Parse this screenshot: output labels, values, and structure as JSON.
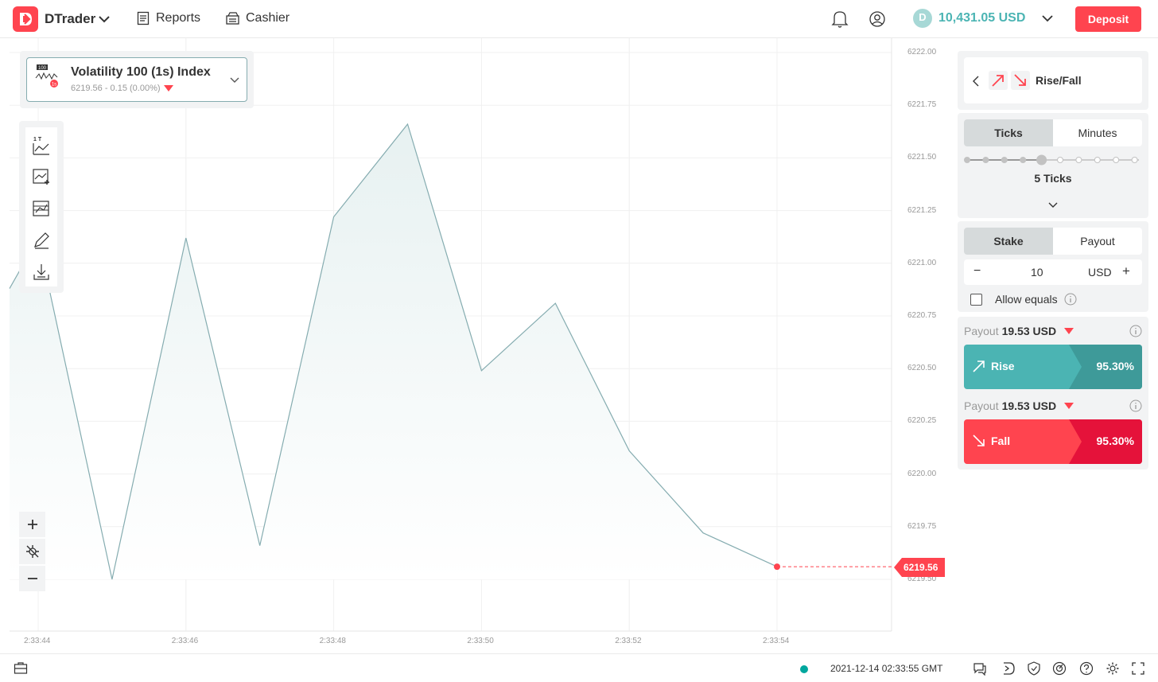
{
  "header": {
    "brand": "DTrader",
    "nav": [
      {
        "label": "Reports",
        "icon": "reports-icon"
      },
      {
        "label": "Cashier",
        "icon": "cashier-icon"
      }
    ],
    "balance": "10,431.05 USD",
    "currency_badge": "D",
    "deposit_label": "Deposit"
  },
  "market": {
    "title": "Volatility 100 (1s) Index",
    "icon_badge_top": "100",
    "icon_badge_bottom": "1s",
    "subtitle": "6219.56 - 0.15 (0.00%)"
  },
  "chart_toolbar": {
    "chart_type_label": "1 T"
  },
  "chart_data": {
    "type": "area",
    "x": [
      "2:33:43.6",
      "2:33:44",
      "2:33:45",
      "2:33:46",
      "2:33:47",
      "2:33:48",
      "2:33:49",
      "2:33:50",
      "2:33:51",
      "2:33:52",
      "2:33:53",
      "2:33:54"
    ],
    "values": [
      6220.88,
      6221.12,
      6219.5,
      6221.12,
      6219.66,
      6221.22,
      6221.66,
      6220.49,
      6220.81,
      6220.11,
      6219.72,
      6219.56
    ],
    "y_ticks": [
      "6222.00",
      "6221.75",
      "6221.50",
      "6221.25",
      "6221.00",
      "6220.75",
      "6220.50",
      "6220.25",
      "6220.00",
      "6219.75",
      "6219.50"
    ],
    "x_ticks": [
      "2:33:44",
      "2:33:46",
      "2:33:48",
      "2:33:50",
      "2:33:52",
      "2:33:54"
    ],
    "ylim": [
      6219.5,
      6222.0
    ],
    "current_price": "6219.56",
    "line_color": "#85acb0",
    "marker_color": "#ff444f"
  },
  "trade": {
    "contract_type": "Rise/Fall",
    "duration_tabs": [
      "Ticks",
      "Minutes"
    ],
    "duration_active": "Ticks",
    "ticks_value": "5 Ticks",
    "stake_tabs": [
      "Stake",
      "Payout"
    ],
    "stake_active": "Stake",
    "minus_label": "−",
    "plus_label": "+",
    "stake_value": "10",
    "stake_currency": "USD",
    "allow_equals": "Allow equals",
    "payout_label": "Payout",
    "rise": {
      "payout": "19.53 USD",
      "label": "Rise",
      "percent": "95.30%",
      "color": "#4bb4b3"
    },
    "fall": {
      "payout": "19.53 USD",
      "label": "Fall",
      "percent": "95.30%",
      "color": "#ff444f"
    }
  },
  "footer": {
    "datetime": "2021-12-14 02:33:55 GMT"
  }
}
